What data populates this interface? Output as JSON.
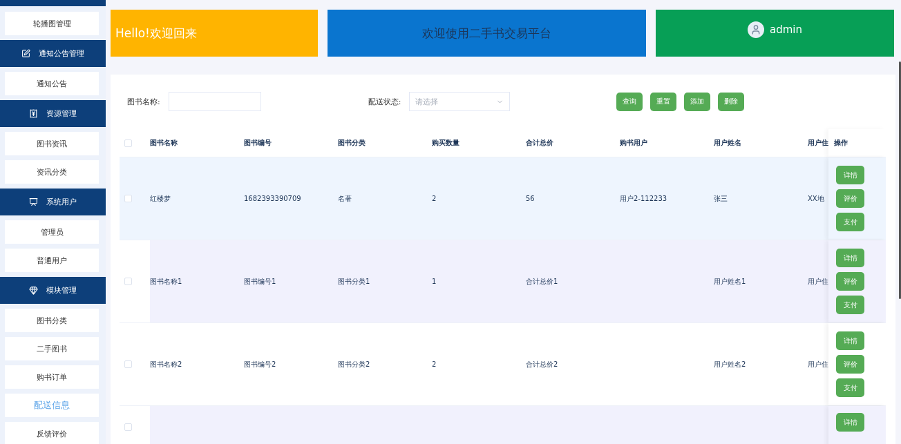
{
  "sidebar": {
    "items": [
      {
        "kind": "item",
        "label": "轮播图管理",
        "selected": false
      },
      {
        "kind": "group",
        "label": "通知公告管理"
      },
      {
        "kind": "item",
        "label": "通知公告",
        "selected": false
      },
      {
        "kind": "group",
        "label": "资源管理"
      },
      {
        "kind": "item",
        "label": "图书资讯",
        "selected": false
      },
      {
        "kind": "item",
        "label": "资讯分类",
        "selected": false
      },
      {
        "kind": "group",
        "label": "系统用户"
      },
      {
        "kind": "item",
        "label": "管理员",
        "selected": false
      },
      {
        "kind": "item",
        "label": "普通用户",
        "selected": false
      },
      {
        "kind": "group",
        "label": "模块管理"
      },
      {
        "kind": "item",
        "label": "图书分类",
        "selected": false
      },
      {
        "kind": "item",
        "label": "二手图书",
        "selected": false
      },
      {
        "kind": "item",
        "label": "购书订单",
        "selected": false
      },
      {
        "kind": "item",
        "label": "配送信息",
        "selected": true
      },
      {
        "kind": "item",
        "label": "反馈评价",
        "selected": false
      }
    ]
  },
  "banners": [
    {
      "kind": "greeting",
      "text": "Hello!欢迎回来",
      "color": "#ffb400"
    },
    {
      "kind": "title",
      "text": "欢迎使用二手书交易平台",
      "color": "#0a75cf"
    },
    {
      "kind": "user",
      "text": "admin",
      "color": "#079f56"
    }
  ],
  "search": {
    "fields": [
      {
        "kind": "input",
        "label": "图书名称:"
      },
      {
        "kind": "select",
        "label": "配送状态:",
        "placeholder": "请选择"
      }
    ],
    "buttons": [
      "查询",
      "重置",
      "添加",
      "删除"
    ]
  },
  "table": {
    "header_checked": false,
    "columns": [
      "图书名称",
      "图书编号",
      "图书分类",
      "购买数量",
      "合计总价",
      "购书用户",
      "用户姓名",
      "用户住",
      "操作"
    ],
    "rows": [
      {
        "checked": false,
        "highlighted": true,
        "cells": [
          "红楼梦",
          "1682393390709",
          "名著",
          "2",
          "56",
          "用户2-112233",
          "张三",
          "XX地"
        ],
        "actions": [
          "详情",
          "评价",
          "支付"
        ]
      },
      {
        "checked": false,
        "highlighted": false,
        "cells": [
          "图书名称1",
          "图书编号1",
          "图书分类1",
          "1",
          "合计总价1",
          "",
          "用户姓名1",
          "用户住"
        ],
        "actions": [
          "详情",
          "评价",
          "支付"
        ]
      },
      {
        "checked": false,
        "highlighted": false,
        "cells": [
          "图书名称2",
          "图书编号2",
          "图书分类2",
          "2",
          "合计总价2",
          "",
          "用户姓名2",
          "用户住"
        ],
        "actions": [
          "详情",
          "评价",
          "支付"
        ]
      },
      {
        "checked": false,
        "highlighted": false,
        "cells": [],
        "actions": [
          "详情"
        ]
      }
    ]
  }
}
